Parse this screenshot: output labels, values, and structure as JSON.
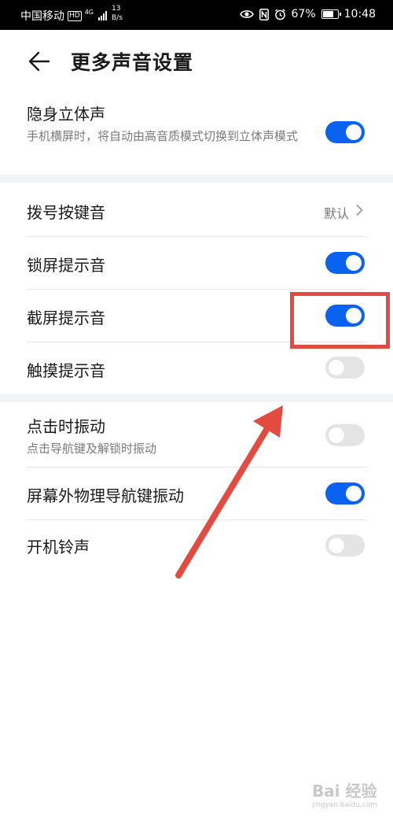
{
  "status_bar": {
    "carrier": "中国移动",
    "hd_badge": "HD",
    "network_type": "4G",
    "speed_value": "13",
    "speed_unit": "B/s",
    "battery_percent": "67%",
    "battery_level": 0.67,
    "time": "10:48"
  },
  "header": {
    "title": "更多声音设置"
  },
  "settings": {
    "stereo": {
      "label": "隐身立体声",
      "subtitle": "手机横屏时，将自动由高音质模式切换到立体声模式",
      "on": true
    },
    "dial_tone": {
      "label": "拨号按键音",
      "value": "默认"
    },
    "lock_sound": {
      "label": "锁屏提示音",
      "on": true
    },
    "screenshot_sound": {
      "label": "截屏提示音",
      "on": true
    },
    "touch_sound": {
      "label": "触摸提示音",
      "on": false
    },
    "tap_vibration": {
      "label": "点击时振动",
      "subtitle": "点击导航键及解锁时振动",
      "on": false
    },
    "nav_key_vibration": {
      "label": "屏幕外物理导航键振动",
      "on": true
    },
    "boot_sound": {
      "label": "开机铃声",
      "on": false
    }
  },
  "watermark": {
    "brand": "Bai 经验",
    "url": "jingyan.baidu.com"
  },
  "colors": {
    "accent": "#0a62f0",
    "annotation": "#e34b41",
    "toggle_off": "#e4e4e4"
  },
  "icons": {
    "back": "back-arrow-icon",
    "chevron": "chevron-right-icon"
  }
}
